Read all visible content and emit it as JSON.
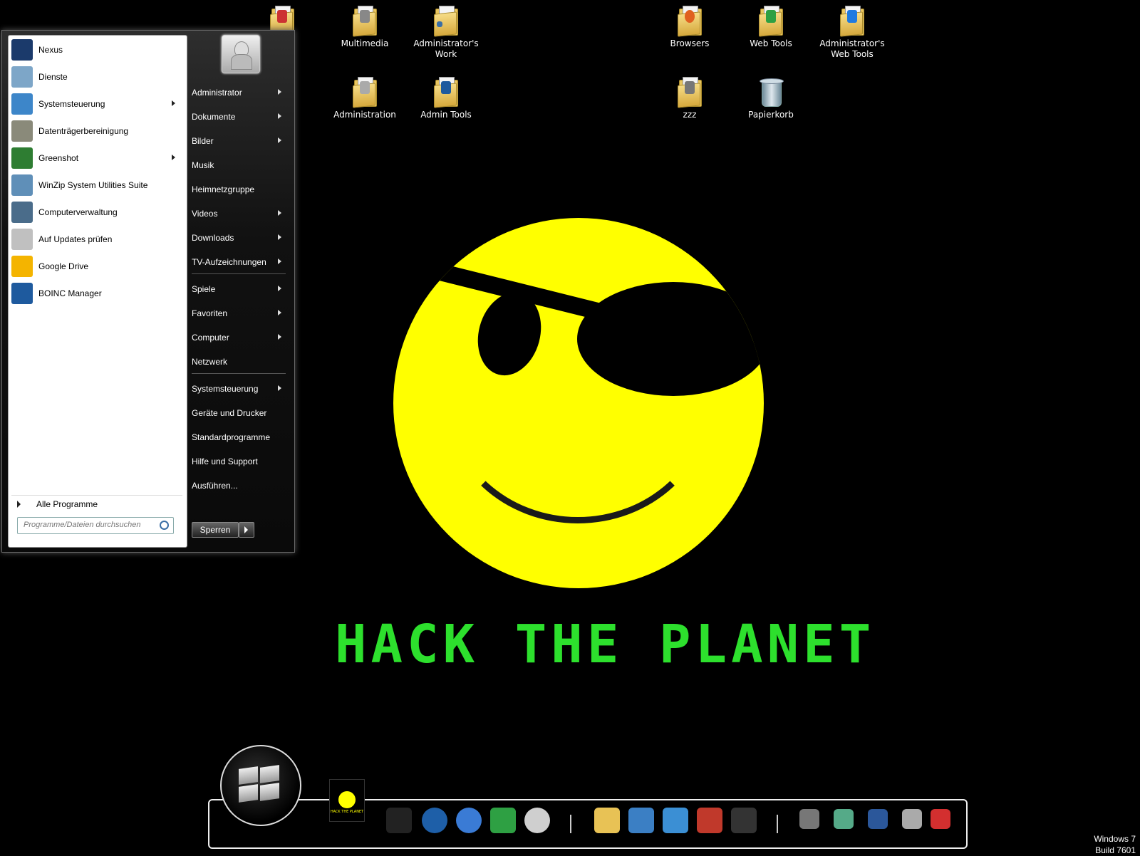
{
  "desktop": {
    "icons": [
      {
        "label": "Multimedia"
      },
      {
        "label": "Administrator's Work"
      },
      {
        "label": "Browsers"
      },
      {
        "label": "Web Tools"
      },
      {
        "label": "Administrator's Web Tools"
      },
      {
        "label": "Administration"
      },
      {
        "label": "Admin Tools"
      },
      {
        "label": "zzz"
      },
      {
        "label": "Papierkorb"
      }
    ]
  },
  "start_menu": {
    "programs": [
      {
        "label": "Nexus",
        "icon": "nexus-icon",
        "color": "#1b3a6b",
        "submenu": false
      },
      {
        "label": "Dienste",
        "icon": "gears-icon",
        "color": "#7da6c8",
        "submenu": false
      },
      {
        "label": "Systemsteuerung",
        "icon": "control-panel-icon",
        "color": "#3d86c9",
        "submenu": true
      },
      {
        "label": "Datenträgerbereinigung",
        "icon": "disk-cleanup-icon",
        "color": "#8a8a7a",
        "submenu": false
      },
      {
        "label": "Greenshot",
        "icon": "greenshot-icon",
        "color": "#2e7d32",
        "submenu": true
      },
      {
        "label": "WinZip System Utilities Suite",
        "icon": "winzip-icon",
        "color": "#5f8fb8",
        "submenu": false
      },
      {
        "label": "Computerverwaltung",
        "icon": "computer-management-icon",
        "color": "#4a6c8a",
        "submenu": false
      },
      {
        "label": "Auf Updates prüfen",
        "icon": "java-icon",
        "color": "#c0c0c0",
        "submenu": false
      },
      {
        "label": "Google Drive",
        "icon": "google-drive-icon",
        "color": "#f4b400",
        "submenu": false
      },
      {
        "label": "BOINC Manager",
        "icon": "boinc-icon",
        "color": "#1e5a9e",
        "submenu": false
      }
    ],
    "all_programs": "Alle Programme",
    "search_placeholder": "Programme/Dateien durchsuchen",
    "places": [
      {
        "label": "Administrator",
        "submenu": true
      },
      {
        "label": "Dokumente",
        "submenu": true
      },
      {
        "label": "Bilder",
        "submenu": true
      },
      {
        "label": "Musik",
        "submenu": false
      },
      {
        "label": "Heimnetzgruppe",
        "submenu": false
      },
      {
        "label": "Videos",
        "submenu": true
      },
      {
        "label": "Downloads",
        "submenu": true
      },
      {
        "label": "TV-Aufzeichnungen",
        "submenu": true
      },
      {
        "label": "Spiele",
        "submenu": true
      },
      {
        "label": "Favoriten",
        "submenu": true
      },
      {
        "label": "Computer",
        "submenu": true
      },
      {
        "label": "Netzwerk",
        "submenu": false
      },
      {
        "label": "Systemsteuerung",
        "submenu": true
      },
      {
        "label": "Geräte und Drucker",
        "submenu": false
      },
      {
        "label": "Standardprogramme",
        "submenu": false
      },
      {
        "label": "Hilfe und Support",
        "submenu": false
      },
      {
        "label": "Ausführen...",
        "submenu": false
      }
    ],
    "lock_button": "Sperren"
  },
  "wallpaper": {
    "text": "HACK THE PLANET",
    "text_color": "#2de02d",
    "smiley_color": "#ffff00"
  },
  "dock": {
    "thumbnail_caption": "HACK THE PLANET",
    "items": [
      {
        "icon": "hack-the-planet-icon",
        "color": "#222"
      },
      {
        "icon": "globe-icon",
        "color": "#1e5fa8"
      },
      {
        "icon": "thunderbird-icon",
        "color": "#3a7bd5"
      },
      {
        "icon": "recycle-icon",
        "color": "#2ea043"
      },
      {
        "icon": "clock-icon",
        "color": "#cfcfcf"
      },
      {
        "icon": "folder-icon",
        "color": "#e8c255"
      },
      {
        "icon": "window-add-icon",
        "color": "#3b7fc4"
      },
      {
        "icon": "window-refresh-icon",
        "color": "#3b8fd4"
      },
      {
        "icon": "save-icon",
        "color": "#c0392b"
      },
      {
        "icon": "terminal-icon",
        "color": "#333"
      },
      {
        "icon": "tray-network-icon",
        "color": "#777"
      },
      {
        "icon": "tray-display-icon",
        "color": "#5a8"
      },
      {
        "icon": "tray-word-icon",
        "color": "#2b579a"
      },
      {
        "icon": "tray-volume-icon",
        "color": "#aaa"
      },
      {
        "icon": "tray-flag-icon",
        "color": "#d32f2f"
      }
    ]
  },
  "os_info": {
    "line1": "Windows 7",
    "line2": "Build 7601"
  }
}
